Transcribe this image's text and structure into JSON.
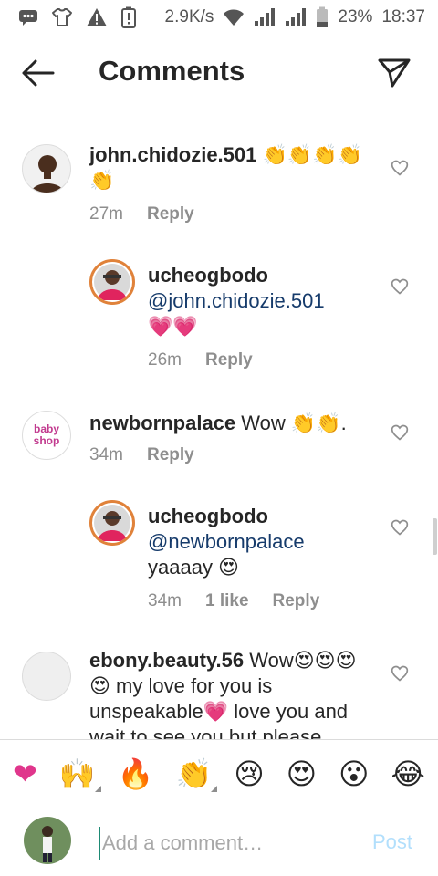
{
  "status_bar": {
    "network_speed": "2.9K/s",
    "battery": "23%",
    "time": "18:37",
    "icons": [
      "message-icon",
      "tshirt-icon",
      "warning-icon",
      "battery-alert-icon",
      "wifi-icon",
      "signal-icon",
      "signal-icon",
      "battery-icon"
    ]
  },
  "header": {
    "title": "Comments",
    "back_icon": "arrow-left-icon",
    "send_icon": "paper-plane-icon"
  },
  "comments": [
    {
      "username": "john.chidozie.501",
      "text": "👏👏👏👏👏",
      "time": "27m",
      "reply_label": "Reply"
    },
    {
      "username": "ucheogbodo",
      "mention": "@john.chidozie.501",
      "text": "💗💗",
      "time": "26m",
      "reply_label": "Reply"
    },
    {
      "username": "newbornpalace",
      "text": "Wow 👏👏.",
      "time": "34m",
      "reply_label": "Reply",
      "avatar_text": "baby shop"
    },
    {
      "username": "ucheogbodo",
      "mention": "@newbornpalace",
      "text": "yaaaay 😍",
      "time": "34m",
      "likes": "1 like",
      "reply_label": "Reply"
    },
    {
      "username": "ebony.beauty.56",
      "text": "Wow😍😍😍😍 my love for you is unspeakable💗 love you and wait to see you but please"
    }
  ],
  "emoji_bar": [
    "❤",
    "🙌",
    "🔥",
    "👏",
    "😢",
    "😍",
    "😮",
    "😂"
  ],
  "input": {
    "placeholder": "Add a comment…",
    "post_label": "Post"
  },
  "colors": {
    "accent_blue": "#163b6b",
    "post_disabled": "#b2dffc",
    "muted": "#8e8e8e"
  }
}
